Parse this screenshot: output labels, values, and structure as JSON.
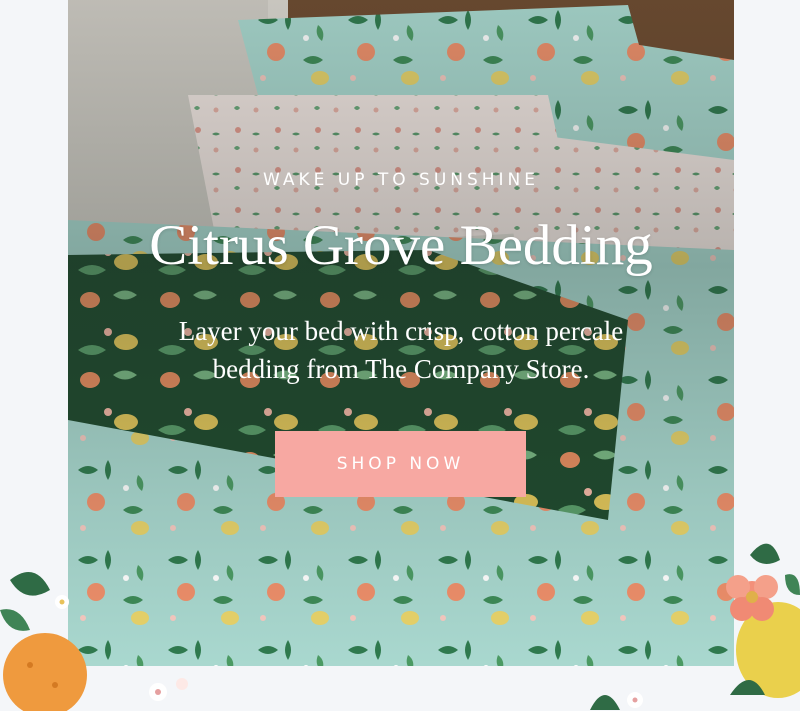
{
  "hero": {
    "eyebrow": "WAKE UP TO SUNSHINE",
    "title": "Citrus Grove Bedding",
    "subtitle_line1": "Layer your bed with crisp, cotton percale",
    "subtitle_line2": "bedding from The Company Store.",
    "cta_label": "SHOP NOW"
  },
  "colors": {
    "page_bg": "#f4f6f9",
    "cta_bg": "#f7a8a2",
    "bedding_mint": "#a9d8cf",
    "pillow_green": "#1f4a2e",
    "orange": "#ef8f6a",
    "lemon": "#e8d36a"
  },
  "icons": [
    "orange-fruit-icon",
    "lemon-fruit-icon",
    "blossom-flower-icon",
    "leaf-icon"
  ]
}
